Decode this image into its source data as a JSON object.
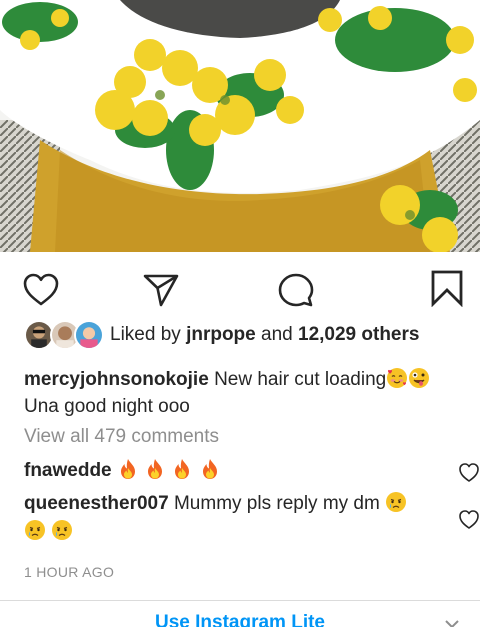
{
  "post": {
    "liked_by_prefix": "Liked by",
    "liked_by_user": "jnrpope",
    "liked_by_and": "and",
    "liked_by_others": "12,029 others",
    "caption_user": "mercyjohnsonokojie",
    "caption_text_1": "New hair cut loading",
    "caption_text_2": "Una good night ooo",
    "view_all": "View all 479 comments",
    "comments": [
      {
        "user": "fnawedde",
        "text": ""
      },
      {
        "user": "queenesther007",
        "text": "Mummy pls reply my dm"
      }
    ],
    "timestamp": "1 HOUR AGO"
  },
  "banner": {
    "label": "Use Instagram Lite"
  },
  "icons": {
    "like": "heart-outline-icon",
    "comment": "comment-bubble-icon",
    "share": "paper-plane-icon",
    "save": "bookmark-icon",
    "emoji_love": "smiling-face-with-hearts-emoji",
    "emoji_wink": "zany-face-emoji",
    "emoji_fire": "fire-emoji",
    "emoji_cry": "crying-face-emoji"
  },
  "colors": {
    "link_blue": "#0095f6",
    "muted_gray": "#8e8e8e",
    "text": "#262626"
  }
}
